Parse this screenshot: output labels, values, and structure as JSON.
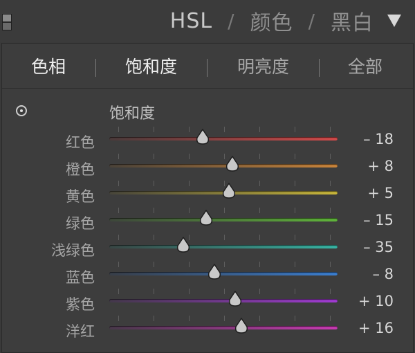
{
  "header": {
    "modes": [
      {
        "label": "HSL",
        "active": true
      },
      {
        "label": "颜色",
        "active": false
      },
      {
        "label": "黑白",
        "active": false
      }
    ],
    "separator": "/",
    "dropdown_icon": "triangle-down-icon"
  },
  "tabs": [
    {
      "label": "色相",
      "active": true
    },
    {
      "label": "饱和度",
      "active": true
    },
    {
      "label": "明亮度",
      "active": false
    },
    {
      "label": "全部",
      "active": false
    }
  ],
  "section": {
    "title": "饱和度",
    "target_icon": "target-adjustment-icon"
  },
  "sliders": [
    {
      "label": "红色",
      "value": -18,
      "display": "– 18",
      "track": [
        "#4a3a3a",
        "#d24a4a"
      ]
    },
    {
      "label": "橙色",
      "value": 8,
      "display": "+ 8",
      "track": [
        "#4a4238",
        "#c9843a"
      ]
    },
    {
      "label": "黄色",
      "value": 5,
      "display": "+ 5",
      "track": [
        "#47453a",
        "#c8b63a"
      ]
    },
    {
      "label": "绿色",
      "value": -15,
      "display": "– 15",
      "track": [
        "#3d463a",
        "#5fb43a"
      ]
    },
    {
      "label": "浅绿色",
      "value": -35,
      "display": "– 35",
      "track": [
        "#384644",
        "#37b3a3"
      ]
    },
    {
      "label": "蓝色",
      "value": -8,
      "display": "– 8",
      "track": [
        "#383e48",
        "#3a7ed0"
      ]
    },
    {
      "label": "紫色",
      "value": 10,
      "display": "+ 10",
      "track": [
        "#43384a",
        "#a03ad2"
      ]
    },
    {
      "label": "洋红",
      "value": 16,
      "display": "+ 16",
      "track": [
        "#48384a",
        "#c83ab2"
      ]
    }
  ],
  "slider_range": [
    -100,
    100
  ]
}
